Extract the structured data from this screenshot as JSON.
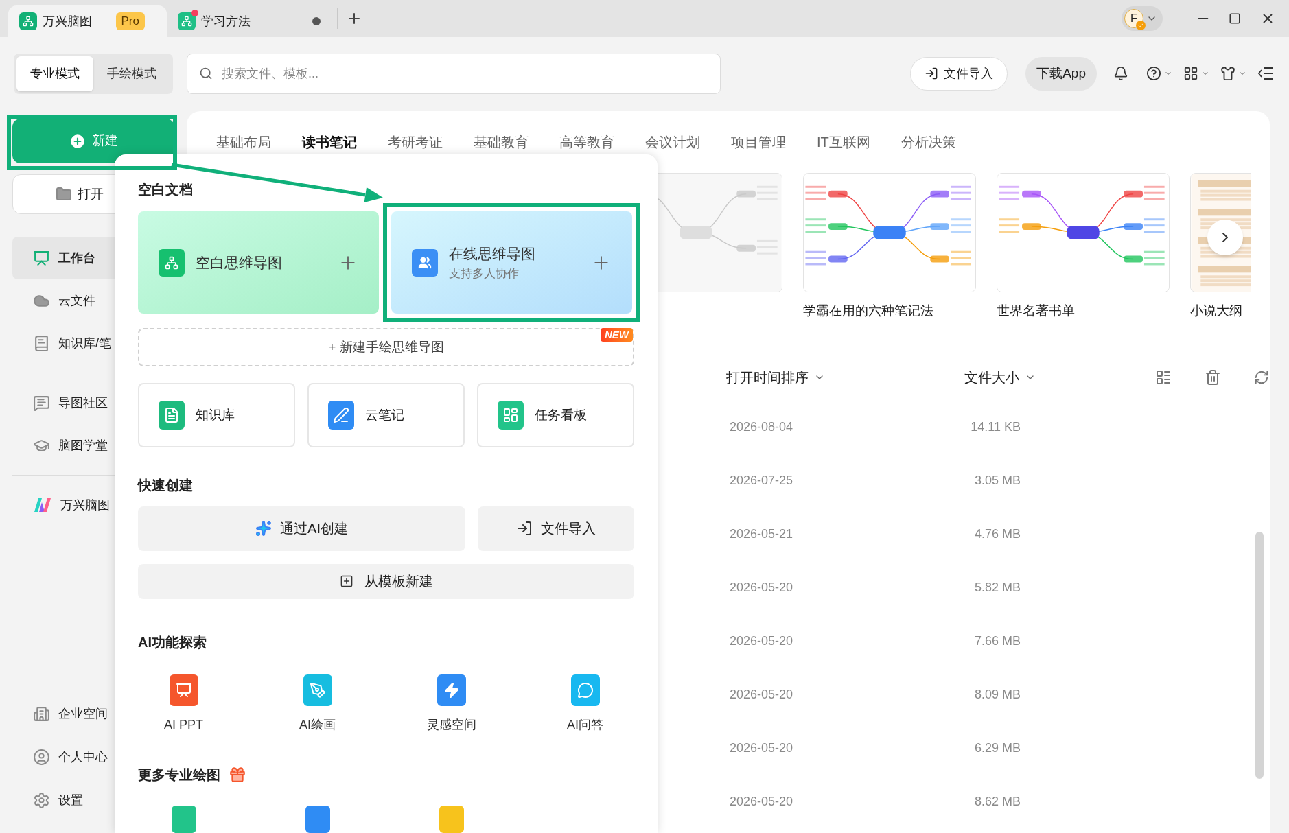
{
  "tabs": [
    {
      "kind": "home",
      "label": "万兴脑图",
      "badge": "Pro",
      "selected": true
    },
    {
      "kind": "file",
      "label": "学习方法",
      "selected": false,
      "unsaved": true
    }
  ],
  "account": {
    "avatar": "F"
  },
  "modes": [
    {
      "label": "专业模式",
      "selected": true
    },
    {
      "label": "手绘模式",
      "selected": false
    }
  ],
  "search": {
    "placeholder": "搜索文件、模板..."
  },
  "toolbar": {
    "import_button": "文件导入",
    "download_button": "下载App"
  },
  "sidebar": {
    "new_button": {
      "label": "新建",
      "highlighted": true
    },
    "open_button": "打开",
    "groups": [
      [
        {
          "label": "工作台",
          "selected": true
        },
        {
          "label": "云文件",
          "selected": false
        },
        {
          "label": "知识库/笔",
          "selected": false
        }
      ],
      [
        {
          "label": "导图社区",
          "selected": false
        },
        {
          "label": "脑图学堂",
          "selected": false
        }
      ],
      [
        {
          "label": "万兴脑图",
          "selected": false
        }
      ]
    ],
    "bottom_items": [
      {
        "label": "企业空间"
      },
      {
        "label": "个人中心"
      },
      {
        "label": "设置"
      }
    ]
  },
  "categories": [
    {
      "label": "基础布局",
      "selected": false
    },
    {
      "label": "读书笔记",
      "selected": true
    },
    {
      "label": "考研考证",
      "selected": false
    },
    {
      "label": "基础教育",
      "selected": false
    },
    {
      "label": "高等教育",
      "selected": false
    },
    {
      "label": "会议计划",
      "selected": false
    },
    {
      "label": "项目管理",
      "selected": false
    },
    {
      "label": "IT互联网",
      "selected": false
    },
    {
      "label": "分析决策",
      "selected": false
    }
  ],
  "templates": [
    {
      "kind": "picture"
    },
    {
      "kind": "picture",
      "title": "学霸在用的六种笔记法"
    },
    {
      "kind": "picture",
      "title": "世界名著书单"
    },
    {
      "kind": "picture",
      "title": "小说大纲"
    }
  ],
  "file_list": {
    "sort_label": "打开时间排序",
    "size_label": "文件大小",
    "rows": [
      {
        "date": "2026-08-04",
        "size": "14.11 KB"
      },
      {
        "date": "2026-07-25",
        "size": "3.05 MB"
      },
      {
        "date": "2026-05-21",
        "size": "4.76 MB"
      },
      {
        "date": "2026-05-20",
        "size": "5.82 MB"
      },
      {
        "date": "2026-05-20",
        "size": "7.66 MB"
      },
      {
        "date": "2026-05-20",
        "size": "8.09 MB"
      },
      {
        "date": "2026-05-20",
        "size": "6.29 MB"
      },
      {
        "date": "2026-05-20",
        "size": "8.62 MB"
      }
    ]
  },
  "new_menu": {
    "blank_heading": "空白文档",
    "blank_cards": [
      {
        "kind": "local",
        "title": "空白思维导图",
        "highlighted": false
      },
      {
        "kind": "online",
        "title": "在线思维导图",
        "subtitle": "支持多人协作",
        "highlighted": true
      }
    ],
    "hand_drawn": {
      "label": "+ 新建手绘思维导图",
      "badge": "NEW"
    },
    "apps": [
      {
        "label": "知识库"
      },
      {
        "label": "云笔记"
      },
      {
        "label": "任务看板"
      }
    ],
    "quick_heading": "快速创建",
    "quick": [
      {
        "label": "通过AI创建"
      },
      {
        "label": "文件导入"
      },
      {
        "label": "从模板新建"
      }
    ],
    "ai_heading": "AI功能探索",
    "ai_tools": [
      {
        "label": "AI PPT"
      },
      {
        "label": "AI绘画"
      },
      {
        "label": "灵感空间"
      },
      {
        "label": "AI问答"
      }
    ],
    "more_heading": "更多专业绘图"
  }
}
